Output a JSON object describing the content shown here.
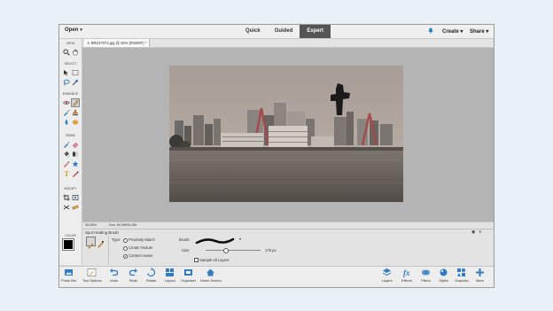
{
  "topbar": {
    "open_label": "Open",
    "modes": [
      "Quick",
      "Guided",
      "Expert"
    ],
    "active_mode": "Expert",
    "create_label": "Create",
    "share_label": "Share"
  },
  "toolbox": {
    "sections": [
      "VIEW",
      "SELECT",
      "ENHANCE",
      "DRAW",
      "MODIFY",
      "COLOR"
    ]
  },
  "document": {
    "tab_title": "BRZ47074.jpg @ 26% (RGB/8*) *",
    "zoom": "26,06%",
    "doc_info": "Doc: 64,3M/64,3M"
  },
  "tool_options": {
    "tool_name": "Spot Healing Brush",
    "type_label": "Type:",
    "type_options": [
      "Proximity Match",
      "Create Texture",
      "Content Aware"
    ],
    "selected_type": "Content Aware",
    "brush_label": "Brush:",
    "size_label": "Size:",
    "size_value": "175 px",
    "sample_all_layers": "Sample All Layers"
  },
  "bottom_left": [
    {
      "label": "Photo Bin",
      "icon": "photo-bin-icon"
    },
    {
      "label": "Tool Options",
      "icon": "tool-options-icon"
    },
    {
      "label": "Undo",
      "icon": "undo-icon"
    },
    {
      "label": "Redo",
      "icon": "redo-icon"
    },
    {
      "label": "Rotate",
      "icon": "rotate-icon"
    },
    {
      "label": "Layout",
      "icon": "layout-icon"
    },
    {
      "label": "Organizer",
      "icon": "organizer-icon"
    },
    {
      "label": "Home Screen",
      "icon": "home-screen-icon"
    }
  ],
  "bottom_right": [
    {
      "label": "Layers",
      "icon": "layers-icon"
    },
    {
      "label": "Effects",
      "icon": "effects-icon"
    },
    {
      "label": "Filters",
      "icon": "filters-icon"
    },
    {
      "label": "Styles",
      "icon": "styles-icon"
    },
    {
      "label": "Graphics",
      "icon": "graphics-icon"
    },
    {
      "label": "More",
      "icon": "more-icon"
    }
  ],
  "colors": {
    "accent": "#2f7bc4",
    "active_mode_bg": "#555555",
    "canvas_bg": "#b4b4b4"
  }
}
